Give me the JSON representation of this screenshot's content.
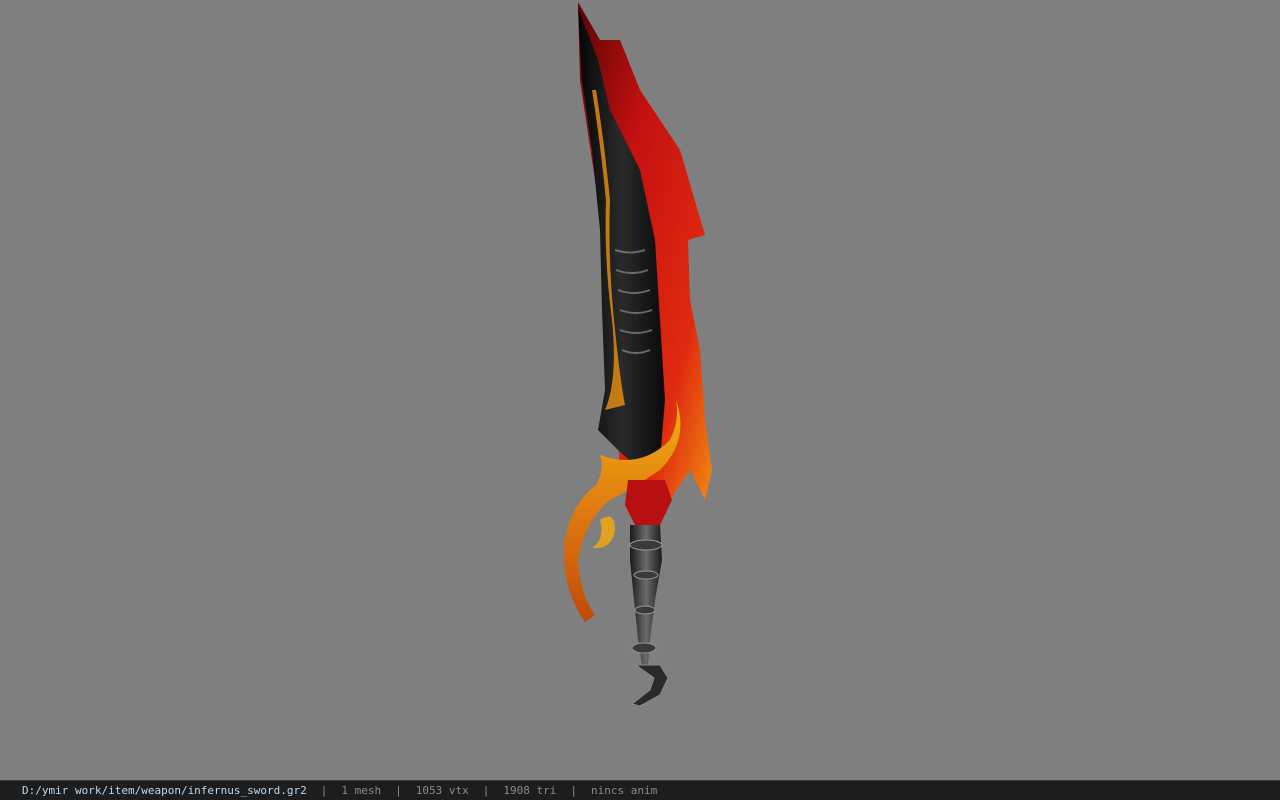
{
  "viewer": {
    "background_color": "#7f7f7f",
    "model_icon": "flame-sword-model"
  },
  "status_bar": {
    "file_path": "D:/ymir work/item/weapon/infernus_sword.gr2",
    "separator": "|",
    "mesh_count": "1 mesh",
    "vertex_count": "1053 vtx",
    "triangle_count": "1908 tri",
    "anim_status": "nincs anim"
  }
}
